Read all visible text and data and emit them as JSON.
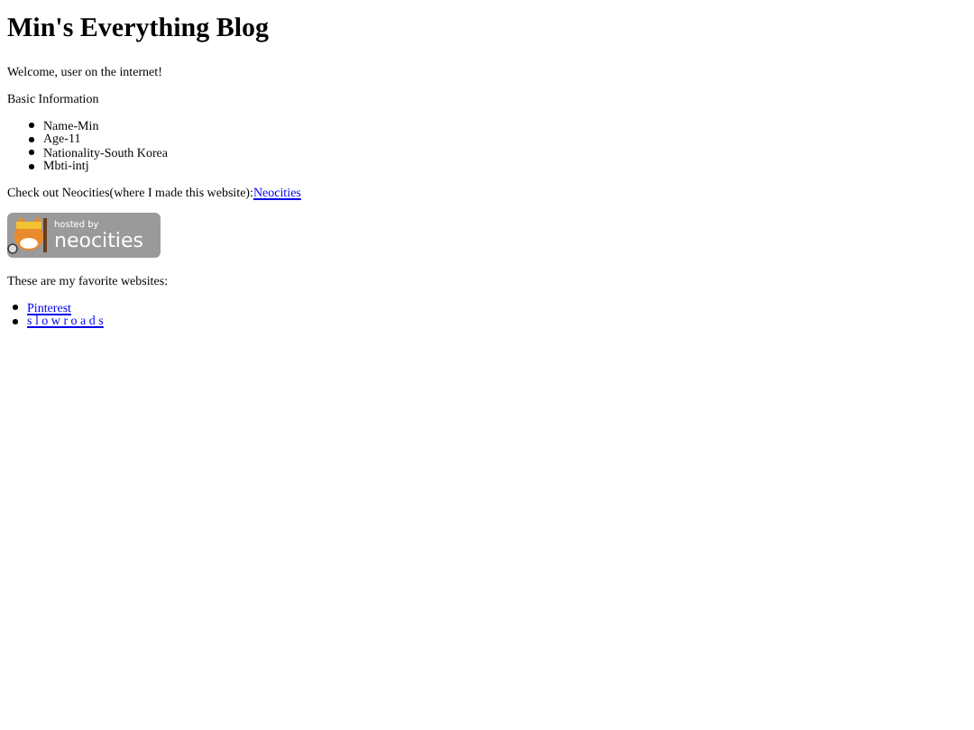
{
  "title": "Min's Everything Blog",
  "welcome": "Welcome, user on the internet!",
  "info_heading": "Basic Information",
  "info": [
    "Name-Min",
    "Age-11",
    "Nationality-South Korea",
    "Mbti-intj"
  ],
  "neocities_line": {
    "text": "Check out Neocities(where I made this website): ",
    "link": "Neocities"
  },
  "badge": {
    "top": "hosted by",
    "bottom": "neocities"
  },
  "favorites_heading": "These are my favorite websites:",
  "favorites": [
    "Pinterest",
    "s l o w r o a d s"
  ]
}
